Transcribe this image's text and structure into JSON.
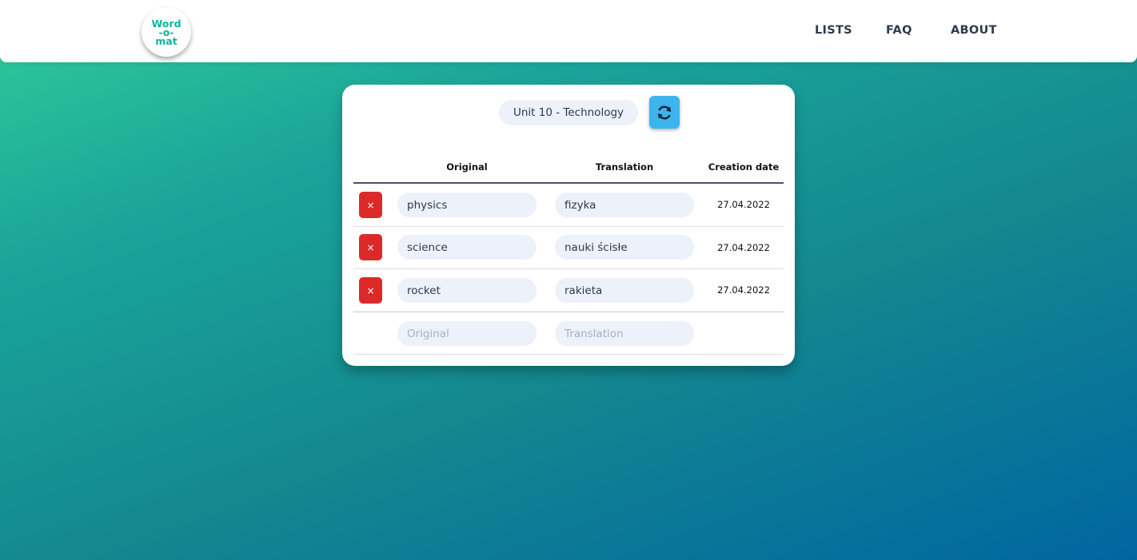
{
  "logo": {
    "line1": "Word",
    "line2": "-o-",
    "line3": "mat"
  },
  "nav": {
    "lists": "LISTS",
    "faq": "FAQ",
    "about": "ABOUT"
  },
  "list": {
    "title": "Unit 10 - Technology"
  },
  "table": {
    "headers": {
      "original": "Original",
      "translation": "Translation",
      "date": "Creation date"
    },
    "rows": [
      {
        "original": "physics",
        "translation": "fizyka",
        "date": "27.04.2022"
      },
      {
        "original": "science",
        "translation": "nauki ścisłe",
        "date": "27.04.2022"
      },
      {
        "original": "rocket",
        "translation": "rakieta",
        "date": "27.04.2022"
      }
    ],
    "new_row": {
      "original_placeholder": "Original",
      "translation_placeholder": "Translation"
    },
    "delete_symbol": "×"
  },
  "icons": {
    "refresh": "refresh-icon",
    "delete": "close-icon"
  },
  "colors": {
    "brand": "#12b59a",
    "refresh_button": "#3cb4ee",
    "delete_button": "#dc2a2a",
    "input_bg": "#ecf1fa"
  }
}
